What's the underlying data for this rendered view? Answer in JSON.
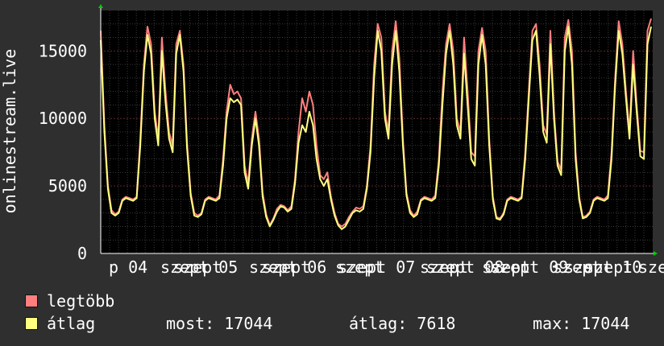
{
  "chart_data": {
    "type": "line",
    "ylabel": "onlinestream.live",
    "ylim": [
      0,
      18000
    ],
    "y_ticks": [
      0,
      5000,
      10000,
      15000
    ],
    "x_tick_labels": [
      "p 04",
      "szept 05",
      "szept 06",
      "szept 07",
      "szept 08",
      "szept 09",
      "szept 10",
      "sze"
    ],
    "x_tick_labels_overlap": [
      "szept",
      "szept",
      "szept",
      "szept",
      "szept",
      "szept",
      "szept"
    ],
    "grid": true,
    "background": "#000000",
    "grid_color": "#5a2a2a",
    "series": [
      {
        "name": "legtöbb",
        "color": "#ff7f7f",
        "values": [
          16500,
          9500,
          5000,
          3200,
          2900,
          3100,
          4000,
          4200,
          4100,
          4000,
          4200,
          8500,
          14000,
          16800,
          15500,
          10500,
          8500,
          16000,
          12000,
          9000,
          8000,
          15500,
          16500,
          14000,
          8200,
          4500,
          3000,
          2800,
          3000,
          4000,
          4200,
          4100,
          4000,
          4300,
          7000,
          10500,
          12500,
          11800,
          12000,
          11500,
          6500,
          5200,
          8500,
          10500,
          8500,
          4500,
          2900,
          2100,
          2600,
          3300,
          3600,
          3500,
          3200,
          3500,
          5500,
          9000,
          11500,
          10500,
          12000,
          11000,
          8000,
          5800,
          5500,
          6000,
          4200,
          3000,
          2200,
          2000,
          2200,
          2700,
          3100,
          3400,
          3300,
          3500,
          5000,
          8000,
          14000,
          17000,
          16000,
          10500,
          9000,
          15000,
          17200,
          14500,
          8500,
          4500,
          3200,
          2800,
          3100,
          4000,
          4200,
          4100,
          4000,
          4300,
          7000,
          12000,
          15500,
          17000,
          15000,
          10000,
          9000,
          16000,
          12000,
          7500,
          7200,
          15000,
          16700,
          15000,
          8500,
          4200,
          2700,
          2600,
          3000,
          4000,
          4200,
          4100,
          4000,
          4200,
          7500,
          12000,
          16500,
          17000,
          14000,
          9500,
          8800,
          16500,
          10500,
          6800,
          6200,
          16000,
          17300,
          15000,
          7500,
          4200,
          2700,
          2800,
          3100,
          4000,
          4200,
          4100,
          4000,
          4300,
          7500,
          13000,
          17200,
          15500,
          12000,
          9000,
          15000,
          11000,
          7600,
          7500,
          16500,
          17400
        ]
      },
      {
        "name": "átlag",
        "color": "#ffff80",
        "values": [
          15800,
          9000,
          4800,
          3000,
          2800,
          3000,
          3900,
          4100,
          4000,
          3900,
          4100,
          8000,
          13500,
          16200,
          14800,
          10000,
          8000,
          15000,
          11200,
          8500,
          7500,
          14800,
          16200,
          13500,
          7800,
          4300,
          2800,
          2700,
          2900,
          3900,
          4100,
          4000,
          3900,
          4100,
          6500,
          10000,
          11500,
          11200,
          11400,
          11000,
          6000,
          4800,
          8000,
          10000,
          8000,
          4200,
          2700,
          2000,
          2500,
          3100,
          3500,
          3400,
          3100,
          3300,
          5200,
          8200,
          9500,
          9000,
          10500,
          9500,
          7000,
          5500,
          5000,
          5500,
          4000,
          2800,
          2100,
          1800,
          2000,
          2500,
          3000,
          3200,
          3100,
          3300,
          4800,
          7500,
          13000,
          16500,
          15000,
          10000,
          8500,
          14000,
          16500,
          13500,
          8000,
          4300,
          3000,
          2700,
          2900,
          3900,
          4100,
          4000,
          3900,
          4100,
          6500,
          11000,
          14800,
          16500,
          14000,
          9500,
          8500,
          14800,
          11000,
          7000,
          6500,
          14000,
          16200,
          14000,
          8000,
          4000,
          2600,
          2500,
          2900,
          3900,
          4100,
          4000,
          3900,
          4100,
          7000,
          11500,
          15800,
          16500,
          13200,
          9000,
          8200,
          15500,
          10000,
          6500,
          5800,
          15000,
          16800,
          14000,
          7000,
          4000,
          2600,
          2700,
          3000,
          3900,
          4100,
          4000,
          3900,
          4100,
          7000,
          12500,
          16500,
          14800,
          11500,
          8500,
          14000,
          10500,
          7200,
          7000,
          15500,
          16800
        ]
      }
    ]
  },
  "legend": [
    {
      "label": "legtöbb",
      "color": "#ff7f7f"
    },
    {
      "label": "átlag",
      "color": "#ffff80"
    }
  ],
  "stats": {
    "most": "most: 17044",
    "atlag": "átlag: 7618",
    "max": "max: 17044"
  }
}
